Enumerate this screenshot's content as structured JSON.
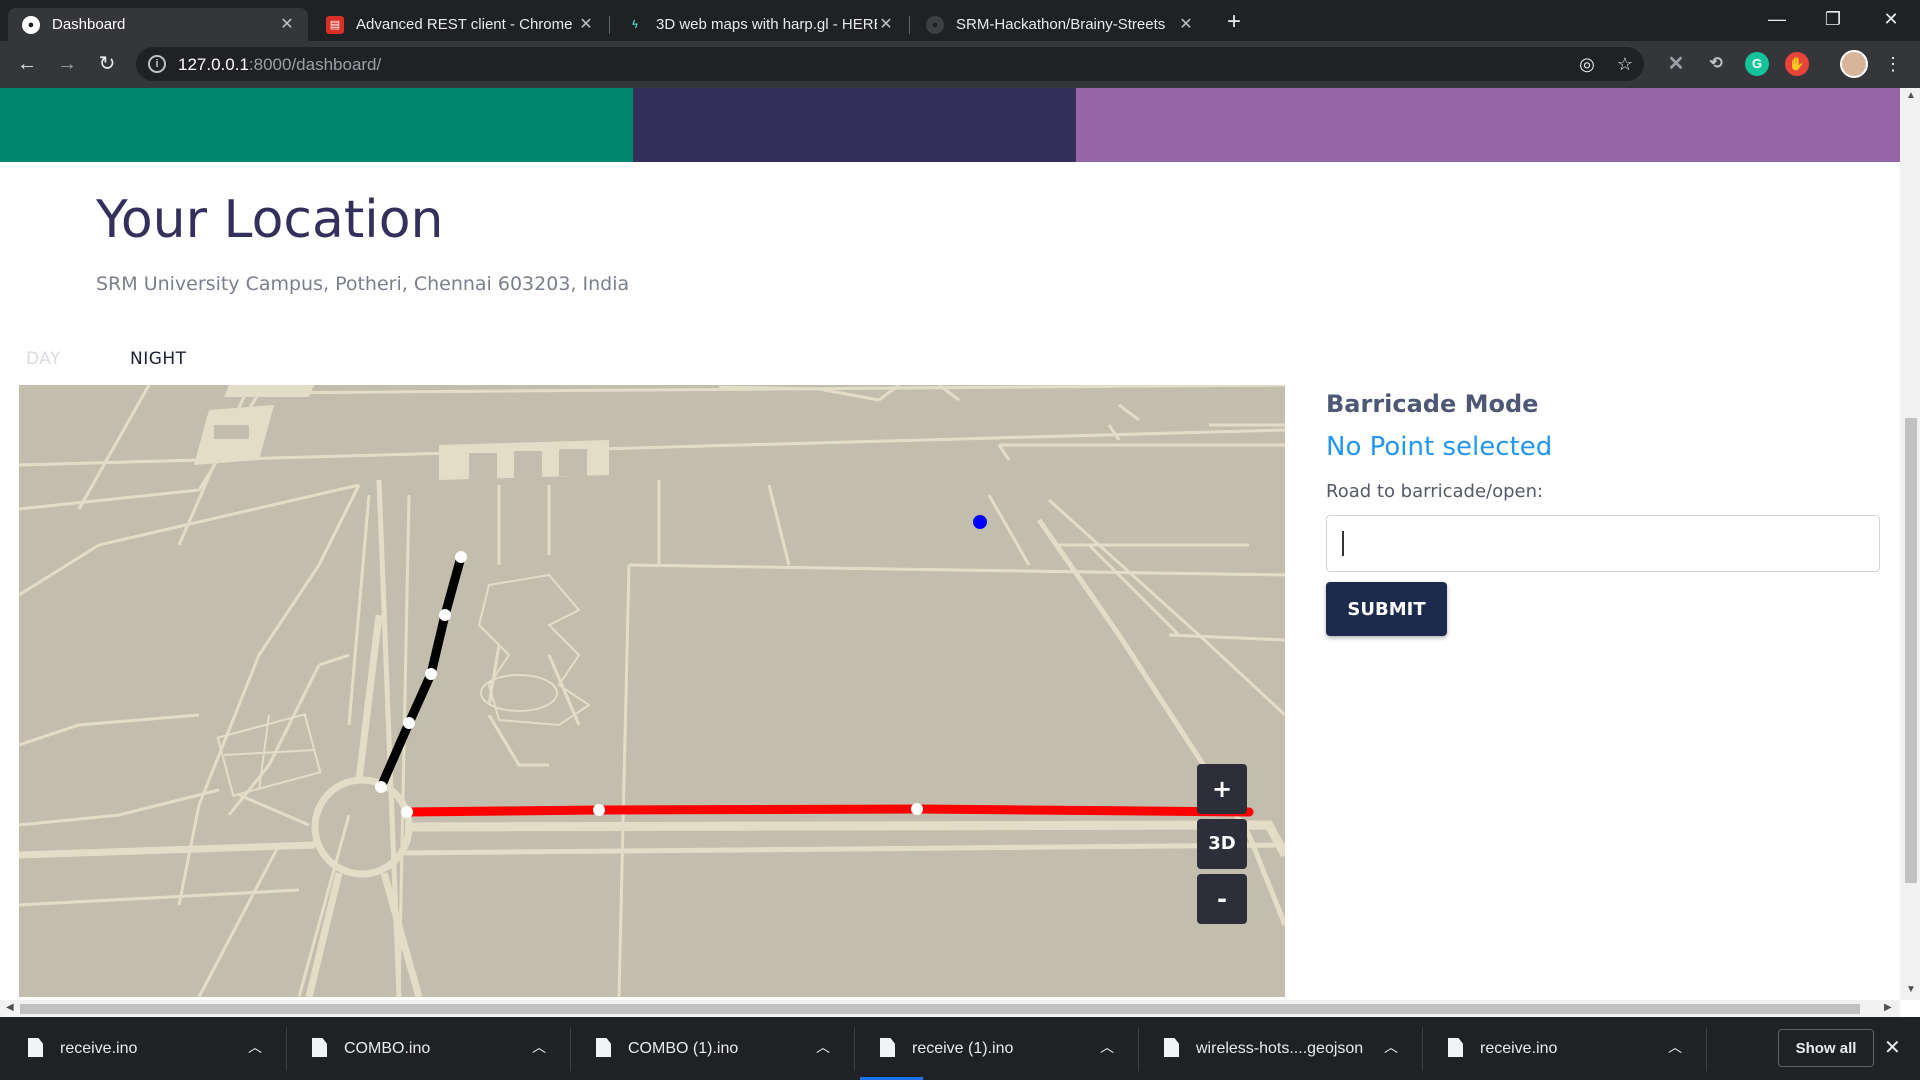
{
  "browser": {
    "tabs": [
      {
        "title": "Dashboard",
        "active": true,
        "icon": "github-icon"
      },
      {
        "title": "Advanced REST client - Chrome V",
        "active": false,
        "icon": "rest-client-icon"
      },
      {
        "title": "3D web maps with harp.gl - HERE",
        "active": false,
        "icon": "harp-icon"
      },
      {
        "title": "SRM-Hackathon/Brainy-Streets",
        "active": false,
        "icon": "github-icon"
      }
    ],
    "url_host": "127.0.0.1",
    "url_rest": ":8000/dashboard/"
  },
  "page": {
    "title": "Your Location",
    "address": "SRM University Campus, Potheri, Chennai 603203, India",
    "mode_tabs": [
      "DAY",
      "NIGHT"
    ],
    "map_controls": {
      "zoom_in": "+",
      "toggle_3d": "3D",
      "zoom_out": "-"
    },
    "sidebar": {
      "heading": "Barricade Mode",
      "status": "No Point selected",
      "input_label": "Road to barricade/open:",
      "input_value": "",
      "submit_label": "SUBMIT"
    },
    "colors": {
      "band_teal": "#00856f",
      "band_navy": "#33305c",
      "band_purple": "#9565a8",
      "route_black": "#000000",
      "route_red": "#ff0000",
      "marker_blue": "#0000ff",
      "status_blue": "#2196f3"
    }
  },
  "downloads": {
    "items": [
      "receive.ino",
      "COMBO.ino",
      "COMBO (1).ino",
      "receive (1).ino",
      "wireless-hots....geojson",
      "receive.ino"
    ],
    "show_all_label": "Show all"
  }
}
